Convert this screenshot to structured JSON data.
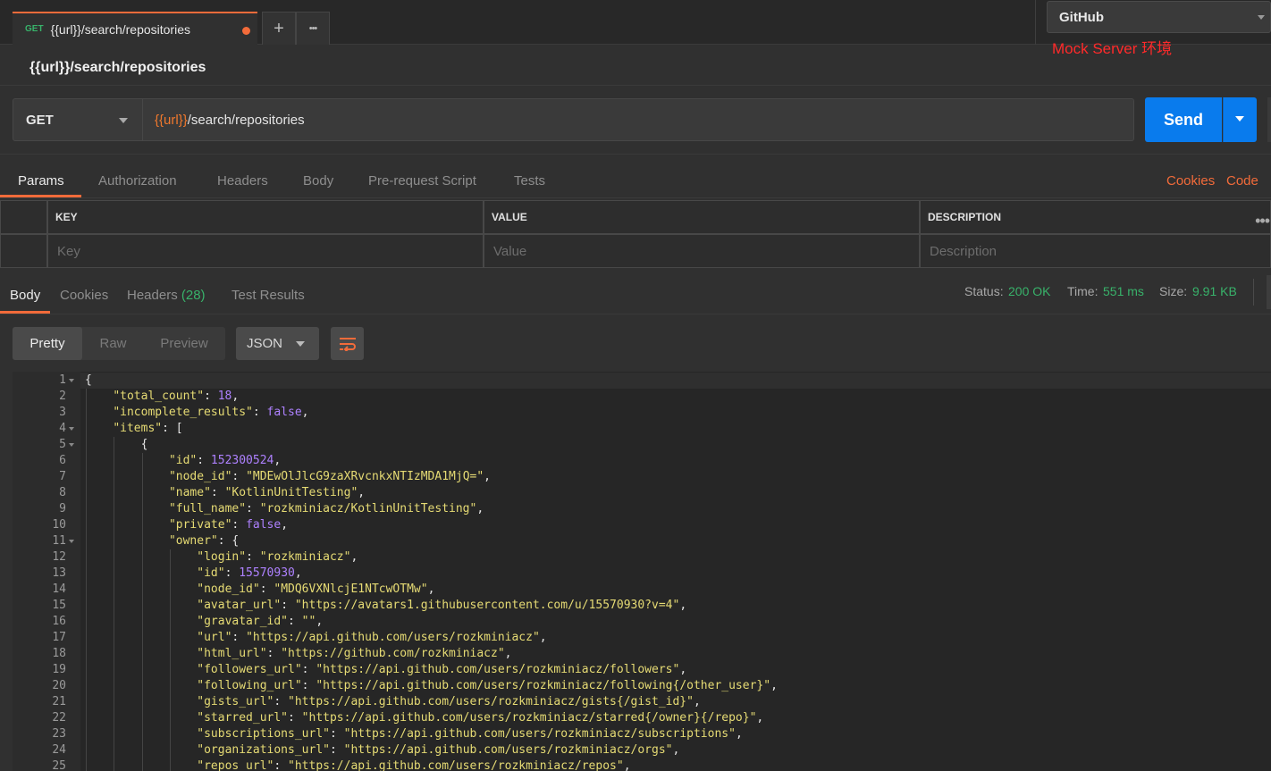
{
  "tabs": {
    "active": {
      "method": "GET",
      "title": "{{url}}/search/repositories"
    },
    "new_tab": "+",
    "more": "•••"
  },
  "environment": {
    "selected": "GitHub"
  },
  "annotation": "Mock Server 环境",
  "request": {
    "title": "{{url}}/search/repositories",
    "method": "GET",
    "url_var": "{{url}}",
    "url_path": "/search/repositories",
    "send_label": "Send"
  },
  "request_tabs": [
    "Params",
    "Authorization",
    "Headers",
    "Body",
    "Pre-request Script",
    "Tests"
  ],
  "request_links": {
    "cookies": "Cookies",
    "code": "Code"
  },
  "params": {
    "headers": [
      "KEY",
      "VALUE",
      "DESCRIPTION"
    ],
    "placeholders": [
      "Key",
      "Value",
      "Description"
    ]
  },
  "response": {
    "tabs": {
      "body": "Body",
      "cookies": "Cookies",
      "headers": "Headers",
      "headers_count": "(28)",
      "tests": "Test Results"
    },
    "status_label": "Status:",
    "status_value": "200 OK",
    "time_label": "Time:",
    "time_value": "551 ms",
    "size_label": "Size:",
    "size_value": "9.91 KB",
    "views": [
      "Pretty",
      "Raw",
      "Preview"
    ],
    "format": "JSON"
  },
  "colors": {
    "accent": "#f26b3a",
    "send": "#097bed",
    "ok": "#38b26a",
    "annotation": "#ff2a2a"
  },
  "code_lines": [
    {
      "n": "1",
      "fold": true,
      "indent": 0,
      "parts": [
        [
          "p",
          "{"
        ]
      ]
    },
    {
      "n": "2",
      "fold": false,
      "indent": 1,
      "parts": [
        [
          "k",
          "\"total_count\""
        ],
        [
          "p",
          ": "
        ],
        [
          "n",
          "18"
        ],
        [
          "p",
          ","
        ]
      ]
    },
    {
      "n": "3",
      "fold": false,
      "indent": 1,
      "parts": [
        [
          "k",
          "\"incomplete_results\""
        ],
        [
          "p",
          ": "
        ],
        [
          "b",
          "false"
        ],
        [
          "p",
          ","
        ]
      ]
    },
    {
      "n": "4",
      "fold": true,
      "indent": 1,
      "parts": [
        [
          "k",
          "\"items\""
        ],
        [
          "p",
          ": ["
        ]
      ]
    },
    {
      "n": "5",
      "fold": true,
      "indent": 2,
      "parts": [
        [
          "p",
          "{"
        ]
      ]
    },
    {
      "n": "6",
      "fold": false,
      "indent": 3,
      "parts": [
        [
          "k",
          "\"id\""
        ],
        [
          "p",
          ": "
        ],
        [
          "n",
          "152300524"
        ],
        [
          "p",
          ","
        ]
      ]
    },
    {
      "n": "7",
      "fold": false,
      "indent": 3,
      "parts": [
        [
          "k",
          "\"node_id\""
        ],
        [
          "p",
          ": "
        ],
        [
          "s",
          "\"MDEwOlJlcG9zaXRvcnkxNTIzMDA1MjQ=\""
        ],
        [
          "p",
          ","
        ]
      ]
    },
    {
      "n": "8",
      "fold": false,
      "indent": 3,
      "parts": [
        [
          "k",
          "\"name\""
        ],
        [
          "p",
          ": "
        ],
        [
          "s",
          "\"KotlinUnitTesting\""
        ],
        [
          "p",
          ","
        ]
      ]
    },
    {
      "n": "9",
      "fold": false,
      "indent": 3,
      "parts": [
        [
          "k",
          "\"full_name\""
        ],
        [
          "p",
          ": "
        ],
        [
          "s",
          "\"rozkminiacz/KotlinUnitTesting\""
        ],
        [
          "p",
          ","
        ]
      ]
    },
    {
      "n": "10",
      "fold": false,
      "indent": 3,
      "parts": [
        [
          "k",
          "\"private\""
        ],
        [
          "p",
          ": "
        ],
        [
          "b",
          "false"
        ],
        [
          "p",
          ","
        ]
      ]
    },
    {
      "n": "11",
      "fold": true,
      "indent": 3,
      "parts": [
        [
          "k",
          "\"owner\""
        ],
        [
          "p",
          ": {"
        ]
      ]
    },
    {
      "n": "12",
      "fold": false,
      "indent": 4,
      "parts": [
        [
          "k",
          "\"login\""
        ],
        [
          "p",
          ": "
        ],
        [
          "s",
          "\"rozkminiacz\""
        ],
        [
          "p",
          ","
        ]
      ]
    },
    {
      "n": "13",
      "fold": false,
      "indent": 4,
      "parts": [
        [
          "k",
          "\"id\""
        ],
        [
          "p",
          ": "
        ],
        [
          "n",
          "15570930"
        ],
        [
          "p",
          ","
        ]
      ]
    },
    {
      "n": "14",
      "fold": false,
      "indent": 4,
      "parts": [
        [
          "k",
          "\"node_id\""
        ],
        [
          "p",
          ": "
        ],
        [
          "s",
          "\"MDQ6VXNlcjE1NTcwOTMw\""
        ],
        [
          "p",
          ","
        ]
      ]
    },
    {
      "n": "15",
      "fold": false,
      "indent": 4,
      "parts": [
        [
          "k",
          "\"avatar_url\""
        ],
        [
          "p",
          ": "
        ],
        [
          "s",
          "\"https://avatars1.githubusercontent.com/u/15570930?v=4\""
        ],
        [
          "p",
          ","
        ]
      ]
    },
    {
      "n": "16",
      "fold": false,
      "indent": 4,
      "parts": [
        [
          "k",
          "\"gravatar_id\""
        ],
        [
          "p",
          ": "
        ],
        [
          "s",
          "\"\""
        ],
        [
          "p",
          ","
        ]
      ]
    },
    {
      "n": "17",
      "fold": false,
      "indent": 4,
      "parts": [
        [
          "k",
          "\"url\""
        ],
        [
          "p",
          ": "
        ],
        [
          "s",
          "\"https://api.github.com/users/rozkminiacz\""
        ],
        [
          "p",
          ","
        ]
      ]
    },
    {
      "n": "18",
      "fold": false,
      "indent": 4,
      "parts": [
        [
          "k",
          "\"html_url\""
        ],
        [
          "p",
          ": "
        ],
        [
          "s",
          "\"https://github.com/rozkminiacz\""
        ],
        [
          "p",
          ","
        ]
      ]
    },
    {
      "n": "19",
      "fold": false,
      "indent": 4,
      "parts": [
        [
          "k",
          "\"followers_url\""
        ],
        [
          "p",
          ": "
        ],
        [
          "s",
          "\"https://api.github.com/users/rozkminiacz/followers\""
        ],
        [
          "p",
          ","
        ]
      ]
    },
    {
      "n": "20",
      "fold": false,
      "indent": 4,
      "parts": [
        [
          "k",
          "\"following_url\""
        ],
        [
          "p",
          ": "
        ],
        [
          "s",
          "\"https://api.github.com/users/rozkminiacz/following{/other_user}\""
        ],
        [
          "p",
          ","
        ]
      ]
    },
    {
      "n": "21",
      "fold": false,
      "indent": 4,
      "parts": [
        [
          "k",
          "\"gists_url\""
        ],
        [
          "p",
          ": "
        ],
        [
          "s",
          "\"https://api.github.com/users/rozkminiacz/gists{/gist_id}\""
        ],
        [
          "p",
          ","
        ]
      ]
    },
    {
      "n": "22",
      "fold": false,
      "indent": 4,
      "parts": [
        [
          "k",
          "\"starred_url\""
        ],
        [
          "p",
          ": "
        ],
        [
          "s",
          "\"https://api.github.com/users/rozkminiacz/starred{/owner}{/repo}\""
        ],
        [
          "p",
          ","
        ]
      ]
    },
    {
      "n": "23",
      "fold": false,
      "indent": 4,
      "parts": [
        [
          "k",
          "\"subscriptions_url\""
        ],
        [
          "p",
          ": "
        ],
        [
          "s",
          "\"https://api.github.com/users/rozkminiacz/subscriptions\""
        ],
        [
          "p",
          ","
        ]
      ]
    },
    {
      "n": "24",
      "fold": false,
      "indent": 4,
      "parts": [
        [
          "k",
          "\"organizations_url\""
        ],
        [
          "p",
          ": "
        ],
        [
          "s",
          "\"https://api.github.com/users/rozkminiacz/orgs\""
        ],
        [
          "p",
          ","
        ]
      ]
    },
    {
      "n": "25",
      "fold": false,
      "indent": 4,
      "parts": [
        [
          "k",
          "\"repos_url\""
        ],
        [
          "p",
          ": "
        ],
        [
          "s",
          "\"https://api.github.com/users/rozkminiacz/repos\""
        ],
        [
          "p",
          ","
        ]
      ]
    }
  ]
}
